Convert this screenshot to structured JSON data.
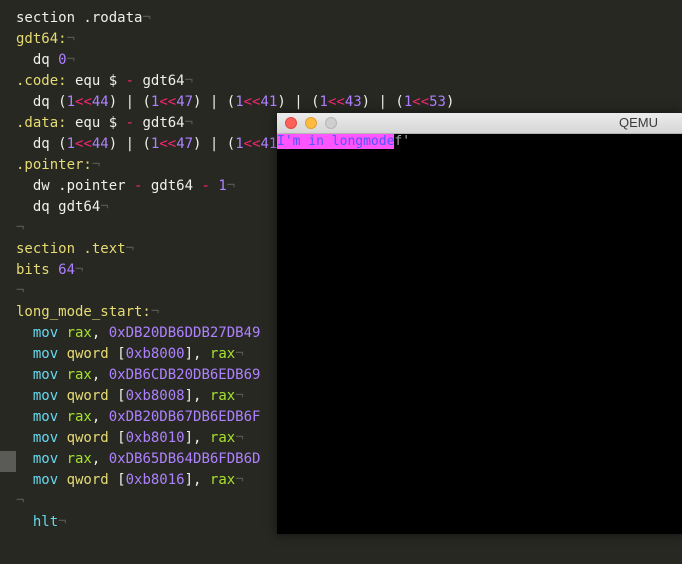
{
  "editor": {
    "lines": [
      [
        {
          "t": "section .rodata",
          "c": "kw"
        },
        {
          "t": "¬",
          "c": "ws"
        }
      ],
      [
        {
          "t": "gdt64:",
          "c": "lbl"
        },
        {
          "t": "¬",
          "c": "ws"
        }
      ],
      [
        {
          "t": "  dq ",
          "c": "kw"
        },
        {
          "t": "0",
          "c": "num"
        },
        {
          "t": "¬",
          "c": "ws"
        }
      ],
      [
        {
          "t": ".code:",
          "c": "lbl"
        },
        {
          "t": " equ $ ",
          "c": "kw"
        },
        {
          "t": "-",
          "c": "op"
        },
        {
          "t": " gdt64",
          "c": "kw"
        },
        {
          "t": "¬",
          "c": "ws"
        }
      ],
      [
        {
          "t": "  dq (",
          "c": "kw"
        },
        {
          "t": "1",
          "c": "num"
        },
        {
          "t": "<<",
          "c": "op"
        },
        {
          "t": "44",
          "c": "num"
        },
        {
          "t": ") | (",
          "c": "kw"
        },
        {
          "t": "1",
          "c": "num"
        },
        {
          "t": "<<",
          "c": "op"
        },
        {
          "t": "47",
          "c": "num"
        },
        {
          "t": ") | (",
          "c": "kw"
        },
        {
          "t": "1",
          "c": "num"
        },
        {
          "t": "<<",
          "c": "op"
        },
        {
          "t": "41",
          "c": "num"
        },
        {
          "t": ") | (",
          "c": "kw"
        },
        {
          "t": "1",
          "c": "num"
        },
        {
          "t": "<<",
          "c": "op"
        },
        {
          "t": "43",
          "c": "num"
        },
        {
          "t": ") | (",
          "c": "kw"
        },
        {
          "t": "1",
          "c": "num"
        },
        {
          "t": "<<",
          "c": "op"
        },
        {
          "t": "53",
          "c": "num"
        },
        {
          "t": ")",
          "c": "kw"
        }
      ],
      [
        {
          "t": ".data:",
          "c": "lbl"
        },
        {
          "t": " equ $ ",
          "c": "kw"
        },
        {
          "t": "-",
          "c": "op"
        },
        {
          "t": " gdt64",
          "c": "kw"
        },
        {
          "t": "¬",
          "c": "ws"
        }
      ],
      [
        {
          "t": "  dq (",
          "c": "kw"
        },
        {
          "t": "1",
          "c": "num"
        },
        {
          "t": "<<",
          "c": "op"
        },
        {
          "t": "44",
          "c": "num"
        },
        {
          "t": ") | (",
          "c": "kw"
        },
        {
          "t": "1",
          "c": "num"
        },
        {
          "t": "<<",
          "c": "op"
        },
        {
          "t": "47",
          "c": "num"
        },
        {
          "t": ") | (",
          "c": "kw"
        },
        {
          "t": "1",
          "c": "num"
        },
        {
          "t": "<<",
          "c": "op"
        },
        {
          "t": "41",
          "c": "num"
        }
      ],
      [
        {
          "t": ".pointer:",
          "c": "lbl"
        },
        {
          "t": "¬",
          "c": "ws"
        }
      ],
      [
        {
          "t": "  dw .pointer ",
          "c": "kw"
        },
        {
          "t": "-",
          "c": "op"
        },
        {
          "t": " gdt64 ",
          "c": "kw"
        },
        {
          "t": "-",
          "c": "op"
        },
        {
          "t": " ",
          "c": "kw"
        },
        {
          "t": "1",
          "c": "num"
        },
        {
          "t": "¬",
          "c": "ws"
        }
      ],
      [
        {
          "t": "  dq gdt64",
          "c": "kw"
        },
        {
          "t": "¬",
          "c": "ws"
        }
      ],
      [
        {
          "t": "¬",
          "c": "ws"
        }
      ],
      [
        {
          "t": "section .text",
          "c": "lbl"
        },
        {
          "t": "¬",
          "c": "ws"
        }
      ],
      [
        {
          "t": "bits ",
          "c": "lbl"
        },
        {
          "t": "64",
          "c": "num"
        },
        {
          "t": "¬",
          "c": "ws"
        }
      ],
      [
        {
          "t": "¬",
          "c": "ws"
        }
      ],
      [
        {
          "t": "long_mode_start:",
          "c": "lbl"
        },
        {
          "t": "¬",
          "c": "ws"
        }
      ],
      [
        {
          "t": "  mov ",
          "c": "ins"
        },
        {
          "t": "rax",
          "c": "reg"
        },
        {
          "t": ", ",
          "c": "kw"
        },
        {
          "t": "0xDB20DB6DDB27DB49",
          "c": "num"
        }
      ],
      [
        {
          "t": "  mov ",
          "c": "ins"
        },
        {
          "t": "qword",
          "c": "lbl"
        },
        {
          "t": " [",
          "c": "kw"
        },
        {
          "t": "0xb8000",
          "c": "num"
        },
        {
          "t": "], ",
          "c": "kw"
        },
        {
          "t": "rax",
          "c": "reg"
        },
        {
          "t": "¬",
          "c": "ws"
        }
      ],
      [
        {
          "t": "  mov ",
          "c": "ins"
        },
        {
          "t": "rax",
          "c": "reg"
        },
        {
          "t": ", ",
          "c": "kw"
        },
        {
          "t": "0xDB6CDB20DB6EDB69",
          "c": "num"
        }
      ],
      [
        {
          "t": "  mov ",
          "c": "ins"
        },
        {
          "t": "qword",
          "c": "lbl"
        },
        {
          "t": " [",
          "c": "kw"
        },
        {
          "t": "0xb8008",
          "c": "num"
        },
        {
          "t": "], ",
          "c": "kw"
        },
        {
          "t": "rax",
          "c": "reg"
        },
        {
          "t": "¬",
          "c": "ws"
        }
      ],
      [
        {
          "t": "  mov ",
          "c": "ins"
        },
        {
          "t": "rax",
          "c": "reg"
        },
        {
          "t": ", ",
          "c": "kw"
        },
        {
          "t": "0xDB20DB67DB6EDB6F",
          "c": "num"
        }
      ],
      [
        {
          "t": "  mov ",
          "c": "ins"
        },
        {
          "t": "qword",
          "c": "lbl"
        },
        {
          "t": " [",
          "c": "kw"
        },
        {
          "t": "0xb8010",
          "c": "num"
        },
        {
          "t": "], ",
          "c": "kw"
        },
        {
          "t": "rax",
          "c": "reg"
        },
        {
          "t": "¬",
          "c": "ws"
        }
      ],
      [
        {
          "t": "  mov ",
          "c": "ins"
        },
        {
          "t": "rax",
          "c": "reg"
        },
        {
          "t": ", ",
          "c": "kw"
        },
        {
          "t": "0xDB65DB64DB6FDB6D",
          "c": "num"
        }
      ],
      [
        {
          "t": "  mov ",
          "c": "ins"
        },
        {
          "t": "qword",
          "c": "lbl"
        },
        {
          "t": " [",
          "c": "kw"
        },
        {
          "t": "0xb8016",
          "c": "num"
        },
        {
          "t": "], ",
          "c": "kw"
        },
        {
          "t": "rax",
          "c": "reg"
        },
        {
          "t": "¬",
          "c": "ws"
        }
      ],
      [
        {
          "t": "¬",
          "c": "ws"
        }
      ],
      [
        {
          "t": "  hlt",
          "c": "ins"
        },
        {
          "t": "¬",
          "c": "ws"
        }
      ]
    ]
  },
  "qemu": {
    "title": "QEMU",
    "output_highlighted": "I'm in longmode",
    "output_rest": "f'"
  }
}
